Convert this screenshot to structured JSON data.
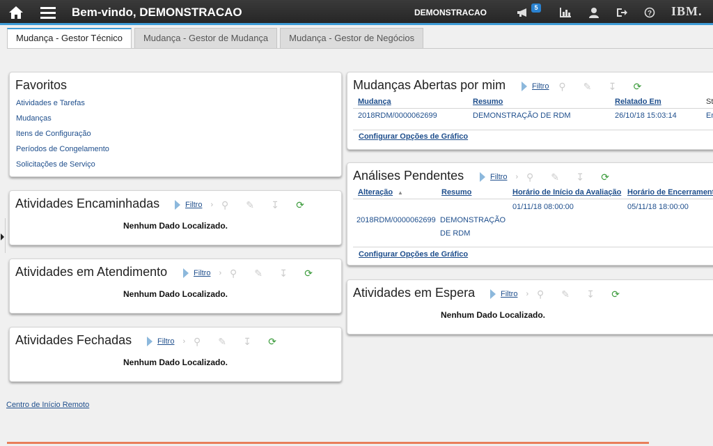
{
  "header": {
    "welcome": "Bem-vindo, DEMONSTRACAO",
    "user": "DEMONSTRACAO",
    "notifications": "5",
    "logo": "IBM."
  },
  "tabs": [
    {
      "label": "Mudança - Gestor Técnico",
      "active": true
    },
    {
      "label": "Mudança - Gestor de Mudança",
      "active": false
    },
    {
      "label": "Mudança - Gestor de Negócios",
      "active": false
    }
  ],
  "favorites": {
    "title": "Favoritos",
    "links": [
      "Atividades e Tarefas",
      "Mudanças",
      "Itens de Configuração",
      "Períodos de Congelamento",
      "Solicitações de Serviço"
    ]
  },
  "common": {
    "filter": "Filtro",
    "no_data": "Nenhum Dado Localizado.",
    "config_chart": "Configurar Opções de Gráfico"
  },
  "portlets": {
    "encaminhadas": "Atividades Encaminhadas",
    "atendimento": "Atividades em Atendimento",
    "fechadas": "Atividades Fechadas",
    "espera": "Atividades em Espera"
  },
  "mudancas_abertas": {
    "title": "Mudanças Abertas por mim",
    "columns": [
      "Mudança",
      "Resumo",
      "Relatado Em",
      "Sta"
    ],
    "row": [
      "2018RDM/0000062699",
      "DEMONSTRAÇÃO DE RDM",
      "26/10/18 15:03:14",
      "En"
    ]
  },
  "analises": {
    "title": "Análises Pendentes",
    "columns": [
      "Alteração",
      "Resumo",
      "Horário de Início da Avaliação",
      "Horário de Encerrament"
    ],
    "row": {
      "id": "2018RDM/0000062699",
      "summary_l1": "DEMONSTRAÇÃO",
      "summary_l2": "DE RDM",
      "start": "01/11/18 08:00:00",
      "end": "05/11/18 18:00:00"
    }
  },
  "footer": {
    "remote": "Centro de Início Remoto"
  },
  "colors": {
    "accent": "#3d9bd6",
    "link": "#1e4e8c",
    "bottom_bar": "#e87e5a"
  }
}
